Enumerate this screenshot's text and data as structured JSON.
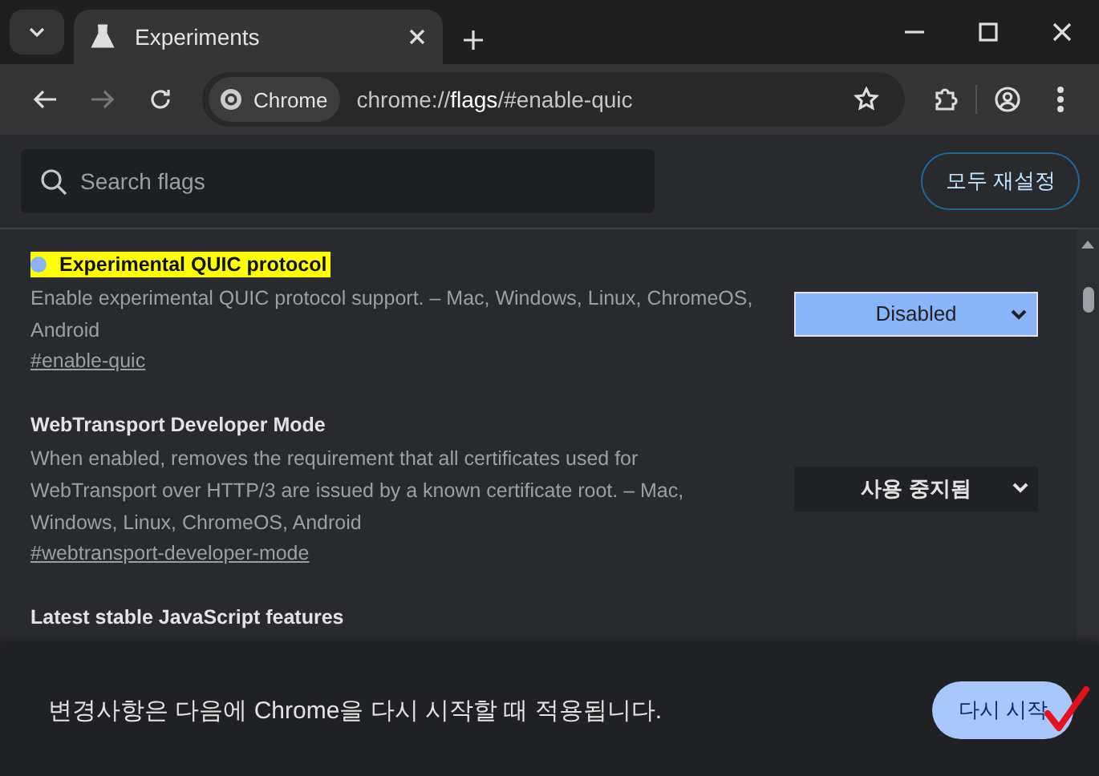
{
  "tab": {
    "title": "Experiments",
    "selected": true
  },
  "address_bar": {
    "chip": "Chrome",
    "url_prefix": "chrome://",
    "url_host": "flags",
    "url_path": "/#enable-quic"
  },
  "search": {
    "placeholder": "Search flags"
  },
  "reset_button": "모두 재설정",
  "flags": [
    {
      "title": "Experimental QUIC protocol",
      "highlighted": true,
      "modified": true,
      "description": "Enable experimental QUIC protocol support. – Mac, Windows, Linux, ChromeOS, Android",
      "link": "#enable-quic",
      "value": "Disabled"
    },
    {
      "title": "WebTransport Developer Mode",
      "highlighted": false,
      "modified": false,
      "description": "When enabled, removes the requirement that all certificates used for WebTransport over HTTP/3 are issued by a known certificate root. – Mac, Windows, Linux, ChromeOS, Android",
      "link": "#webtransport-developer-mode",
      "value": "사용 중지됨"
    },
    {
      "title": "Latest stable JavaScript features",
      "highlighted": false,
      "modified": false
    }
  ],
  "restart_bar": {
    "message": "변경사항은 다음에 Chrome을 다시 시작할 때 적용됩니다.",
    "button": "다시 시작"
  }
}
